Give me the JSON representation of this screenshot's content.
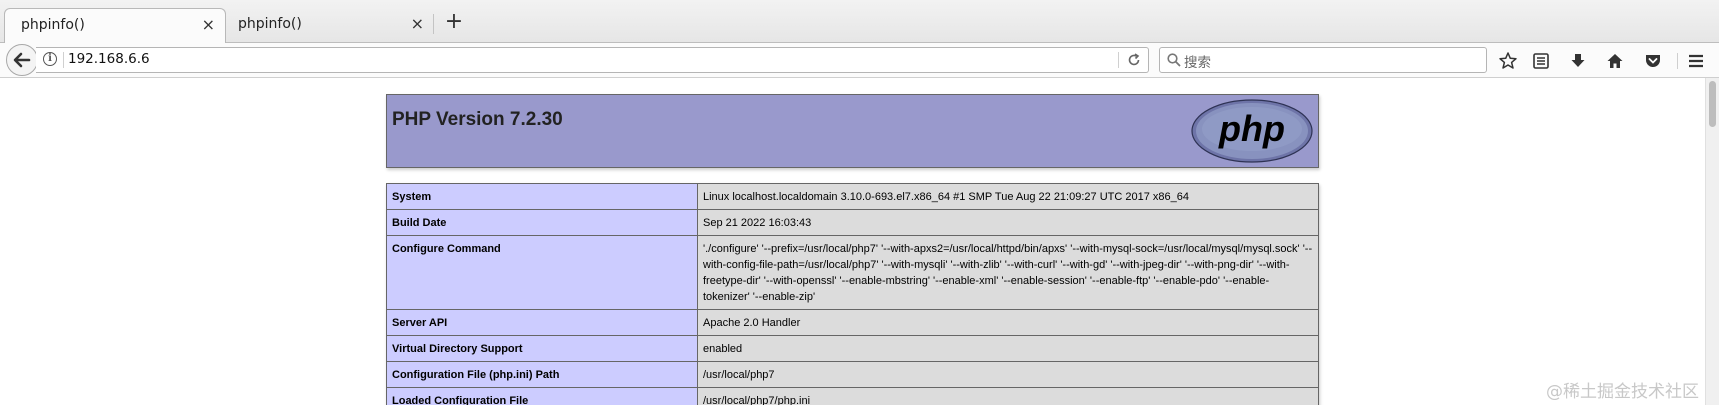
{
  "tabs": [
    {
      "label": "phpinfo()",
      "active": true
    },
    {
      "label": "phpinfo()",
      "active": false
    }
  ],
  "tab_close_glyph": "×",
  "new_tab_glyph": "+",
  "address": {
    "url": "192.168.6.6"
  },
  "search": {
    "placeholder": "搜索"
  },
  "toolbar_icons": [
    "star-icon",
    "reading-list-icon",
    "download-icon",
    "home-icon",
    "pocket-icon",
    "menu-icon"
  ],
  "php": {
    "title": "PHP Version 7.2.30",
    "rows": [
      {
        "key": "System",
        "value": "Linux localhost.localdomain 3.10.0-693.el7.x86_64 #1 SMP Tue Aug 22 21:09:27 UTC 2017 x86_64"
      },
      {
        "key": "Build Date",
        "value": "Sep 21 2022 16:03:43"
      },
      {
        "key": "Configure Command",
        "value": "'./configure' '--prefix=/usr/local/php7' '--with-apxs2=/usr/local/httpd/bin/apxs' '--with-mysql-sock=/usr/local/mysql/mysql.sock' '--with-config-file-path=/usr/local/php7' '--with-mysqli' '--with-zlib' '--with-curl' '--with-gd' '--with-jpeg-dir' '--with-png-dir' '--with-freetype-dir' '--with-openssl' '--enable-mbstring' '--enable-xml' '--enable-session' '--enable-ftp' '--enable-pdo' '--enable-tokenizer' '--enable-zip'"
      },
      {
        "key": "Server API",
        "value": "Apache 2.0 Handler"
      },
      {
        "key": "Virtual Directory Support",
        "value": "enabled"
      },
      {
        "key": "Configuration File (php.ini) Path",
        "value": "/usr/local/php7"
      },
      {
        "key": "Loaded Configuration File",
        "value": "/usr/local/php7/php.ini"
      }
    ]
  },
  "watermark": "@稀土掘金技术社区",
  "colors": {
    "php_header": "#9999cc",
    "key_cell": "#ccccff",
    "value_cell": "#dcdcdc"
  }
}
